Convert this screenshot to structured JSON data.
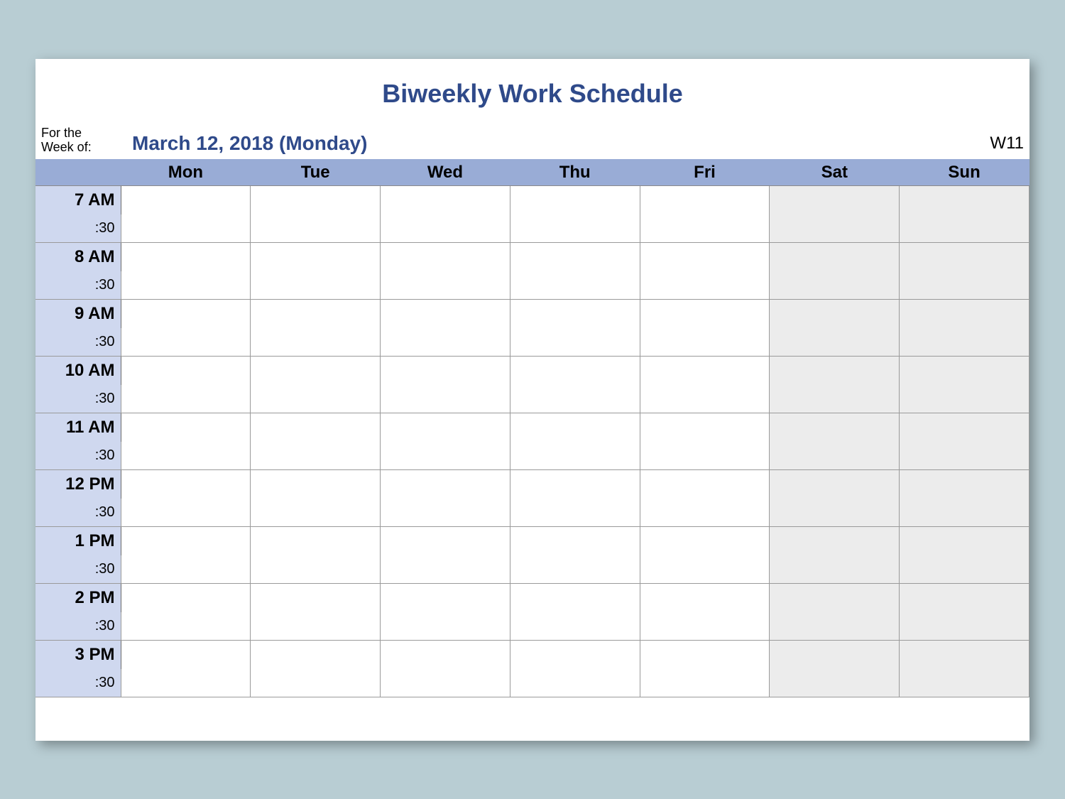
{
  "title": "Biweekly Work Schedule",
  "meta": {
    "label_line1": "For the",
    "label_line2": "Week of:",
    "date": "March 12, 2018 (Monday)",
    "week_number": "W11"
  },
  "days": [
    "Mon",
    "Tue",
    "Wed",
    "Thu",
    "Fri",
    "Sat",
    "Sun"
  ],
  "weekend_indices": [
    5,
    6
  ],
  "times": [
    {
      "hour": "7 AM",
      "half": ":30"
    },
    {
      "hour": "8 AM",
      "half": ":30"
    },
    {
      "hour": "9 AM",
      "half": ":30"
    },
    {
      "hour": "10 AM",
      "half": ":30"
    },
    {
      "hour": "11 AM",
      "half": ":30"
    },
    {
      "hour": "12 PM",
      "half": ":30"
    },
    {
      "hour": "1 PM",
      "half": ":30"
    },
    {
      "hour": "2 PM",
      "half": ":30"
    },
    {
      "hour": "3 PM",
      "half": ":30"
    }
  ]
}
